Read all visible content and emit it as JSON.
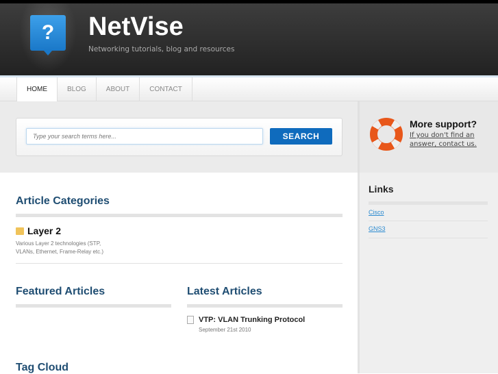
{
  "site": {
    "title": "NetVise",
    "tagline": "Networking tutorials, blog and resources",
    "logo_glyph": "?"
  },
  "nav": [
    {
      "label": "HOME"
    },
    {
      "label": "BLOG"
    },
    {
      "label": "ABOUT"
    },
    {
      "label": "CONTACT"
    }
  ],
  "search": {
    "placeholder": "Type your search terms here...",
    "button": "SEARCH"
  },
  "support": {
    "title": "More support?",
    "link": "If you don't find an answer, contact us."
  },
  "links": {
    "heading": "Links",
    "items": [
      "Cisco",
      "GNS3"
    ]
  },
  "categories": {
    "heading": "Article Categories",
    "items": [
      {
        "title": "Layer 2",
        "desc": "Various Layer 2 technologies (STP, VLANs, Ethernet, Frame-Relay etc.)"
      }
    ]
  },
  "featured": {
    "heading": "Featured Articles"
  },
  "latest": {
    "heading": "Latest Articles",
    "items": [
      {
        "title": "VTP: VLAN Trunking Protocol",
        "date": "September 21st 2010"
      }
    ]
  },
  "tagcloud": {
    "heading": "Tag Cloud"
  }
}
